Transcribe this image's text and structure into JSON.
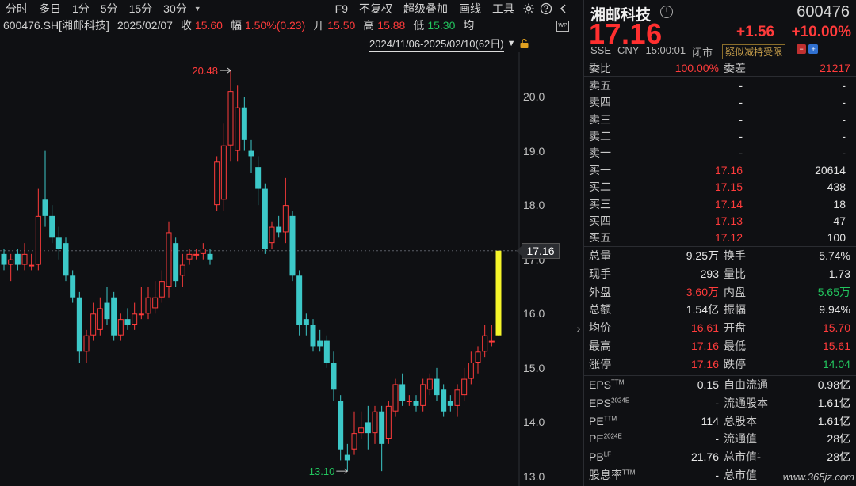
{
  "toolbar": {
    "periods": [
      "分时",
      "多日",
      "1分",
      "5分",
      "15分",
      "30分"
    ],
    "right_items": [
      "F9",
      "不复权",
      "超级叠加",
      "画线",
      "工具"
    ]
  },
  "info": {
    "code_name": "600476.SH[湘邮科技]",
    "date": "2025/02/07",
    "close_label": "收",
    "close": "15.60",
    "amp_label": "幅",
    "amp": "1.50%(0.23)",
    "open_label": "开",
    "open": "15.50",
    "high_label": "高",
    "high": "15.88",
    "low_label": "低",
    "low": "15.30",
    "avg_label": "均",
    "range": "2024/11/06-2025/02/10(62日)",
    "wp_badge": "WP"
  },
  "colors": {
    "up": "#ff3b3b",
    "down": "#3cc8c8",
    "limit_up": "#f5f52a",
    "bg": "#0f1013"
  },
  "chart_data": {
    "type": "candlestick",
    "ylim": [
      13.0,
      20.5
    ],
    "y_ticks": [
      "20.0",
      "19.0",
      "18.0",
      "17.0",
      "16.0",
      "15.0",
      "14.0",
      "13.0"
    ],
    "y_tick_values": [
      20.0,
      19.0,
      18.0,
      17.0,
      16.0,
      15.0,
      14.0,
      13.0
    ],
    "current_price": 17.16,
    "current_price_label": "17.16",
    "max_label": "20.48",
    "max_value": 20.48,
    "min_label": "13.10",
    "min_value": 13.1,
    "candles": [
      {
        "o": 17.1,
        "c": 16.9,
        "h": 17.2,
        "l": 16.8
      },
      {
        "o": 16.9,
        "c": 17.0,
        "h": 17.1,
        "l": 16.6
      },
      {
        "o": 17.1,
        "c": 16.9,
        "h": 17.2,
        "l": 16.8
      },
      {
        "o": 16.9,
        "c": 17.1,
        "h": 17.3,
        "l": 16.8
      },
      {
        "o": 16.9,
        "c": 16.9,
        "h": 17.1,
        "l": 16.8
      },
      {
        "o": 16.9,
        "c": 17.8,
        "h": 18.3,
        "l": 16.8
      },
      {
        "o": 18.1,
        "c": 17.8,
        "h": 19.0,
        "l": 17.6
      },
      {
        "o": 17.8,
        "c": 17.4,
        "h": 18.0,
        "l": 17.3
      },
      {
        "o": 17.4,
        "c": 17.2,
        "h": 17.6,
        "l": 17.0
      },
      {
        "o": 17.3,
        "c": 16.7,
        "h": 17.4,
        "l": 16.6
      },
      {
        "o": 16.7,
        "c": 16.3,
        "h": 16.8,
        "l": 16.2
      },
      {
        "o": 16.3,
        "c": 15.3,
        "h": 16.4,
        "l": 15.1
      },
      {
        "o": 15.3,
        "c": 15.6,
        "h": 15.7,
        "l": 15.1
      },
      {
        "o": 15.6,
        "c": 16.0,
        "h": 16.2,
        "l": 15.5
      },
      {
        "o": 15.7,
        "c": 16.1,
        "h": 16.3,
        "l": 15.6
      },
      {
        "o": 16.2,
        "c": 15.9,
        "h": 16.5,
        "l": 15.8
      },
      {
        "o": 16.3,
        "c": 15.6,
        "h": 16.4,
        "l": 15.5
      },
      {
        "o": 15.6,
        "c": 15.9,
        "h": 16.0,
        "l": 15.5
      },
      {
        "o": 15.9,
        "c": 15.8,
        "h": 16.1,
        "l": 15.7
      },
      {
        "o": 15.8,
        "c": 16.0,
        "h": 16.2,
        "l": 15.7
      },
      {
        "o": 16.0,
        "c": 16.0,
        "h": 16.5,
        "l": 15.9
      },
      {
        "o": 16.0,
        "c": 16.3,
        "h": 16.5,
        "l": 15.9
      },
      {
        "o": 16.1,
        "c": 16.3,
        "h": 16.6,
        "l": 16.0
      },
      {
        "o": 16.3,
        "c": 16.6,
        "h": 16.8,
        "l": 16.2
      },
      {
        "o": 16.5,
        "c": 17.5,
        "h": 17.7,
        "l": 16.3
      },
      {
        "o": 17.3,
        "c": 16.6,
        "h": 17.4,
        "l": 16.5
      },
      {
        "o": 16.7,
        "c": 16.9,
        "h": 17.1,
        "l": 16.5
      },
      {
        "o": 17.0,
        "c": 17.1,
        "h": 17.2,
        "l": 16.9
      },
      {
        "o": 17.1,
        "c": 17.1,
        "h": 17.2,
        "l": 17.0
      },
      {
        "o": 17.1,
        "c": 17.2,
        "h": 17.3,
        "l": 17.0
      },
      {
        "o": 17.1,
        "c": 17.0,
        "h": 17.2,
        "l": 16.9
      },
      {
        "o": 18.0,
        "c": 18.8,
        "h": 18.9,
        "l": 17.9
      },
      {
        "o": 18.1,
        "c": 19.1,
        "h": 19.5,
        "l": 17.9
      },
      {
        "o": 19.1,
        "c": 20.1,
        "h": 20.48,
        "l": 18.8
      },
      {
        "o": 19.0,
        "c": 19.8,
        "h": 20.2,
        "l": 18.8
      },
      {
        "o": 19.8,
        "c": 19.2,
        "h": 20.0,
        "l": 19.0
      },
      {
        "o": 19.0,
        "c": 18.9,
        "h": 19.2,
        "l": 18.6
      },
      {
        "o": 18.7,
        "c": 18.3,
        "h": 18.9,
        "l": 18.0
      },
      {
        "o": 18.3,
        "c": 17.2,
        "h": 18.4,
        "l": 17.1
      },
      {
        "o": 17.3,
        "c": 17.6,
        "h": 17.7,
        "l": 17.2
      },
      {
        "o": 17.6,
        "c": 17.5,
        "h": 17.8,
        "l": 17.4
      },
      {
        "o": 17.5,
        "c": 18.0,
        "h": 18.5,
        "l": 17.3
      },
      {
        "o": 17.8,
        "c": 16.7,
        "h": 17.9,
        "l": 16.6
      },
      {
        "o": 16.7,
        "c": 15.8,
        "h": 16.8,
        "l": 15.6
      },
      {
        "o": 15.9,
        "c": 15.8,
        "h": 16.0,
        "l": 15.6
      },
      {
        "o": 15.8,
        "c": 15.4,
        "h": 15.9,
        "l": 15.3
      },
      {
        "o": 15.5,
        "c": 15.4,
        "h": 15.7,
        "l": 15.3
      },
      {
        "o": 15.5,
        "c": 15.1,
        "h": 15.6,
        "l": 15.0
      },
      {
        "o": 15.1,
        "c": 14.6,
        "h": 15.3,
        "l": 14.4
      },
      {
        "o": 14.4,
        "c": 13.5,
        "h": 14.5,
        "l": 13.3
      },
      {
        "o": 13.4,
        "c": 13.3,
        "h": 13.6,
        "l": 13.1
      },
      {
        "o": 13.5,
        "c": 13.8,
        "h": 14.2,
        "l": 13.4
      },
      {
        "o": 13.8,
        "c": 13.9,
        "h": 14.2,
        "l": 13.7
      },
      {
        "o": 14.0,
        "c": 13.8,
        "h": 14.3,
        "l": 13.5
      },
      {
        "o": 13.8,
        "c": 14.2,
        "h": 14.3,
        "l": 13.6
      },
      {
        "o": 14.2,
        "c": 13.6,
        "h": 14.3,
        "l": 13.1
      },
      {
        "o": 13.7,
        "c": 14.3,
        "h": 14.4,
        "l": 13.6
      },
      {
        "o": 14.2,
        "c": 14.7,
        "h": 14.8,
        "l": 14.1
      },
      {
        "o": 14.7,
        "c": 14.4,
        "h": 14.9,
        "l": 14.3
      },
      {
        "o": 14.4,
        "c": 14.4,
        "h": 14.5,
        "l": 14.3
      },
      {
        "o": 14.4,
        "c": 14.3,
        "h": 14.5,
        "l": 14.2
      },
      {
        "o": 14.3,
        "c": 14.7,
        "h": 14.8,
        "l": 14.2
      },
      {
        "o": 14.6,
        "c": 14.8,
        "h": 14.9,
        "l": 14.5
      },
      {
        "o": 14.8,
        "c": 14.5,
        "h": 15.0,
        "l": 14.4
      },
      {
        "o": 14.6,
        "c": 14.2,
        "h": 14.7,
        "l": 14.1
      },
      {
        "o": 14.4,
        "c": 14.3,
        "h": 14.5,
        "l": 14.2
      },
      {
        "o": 14.3,
        "c": 14.6,
        "h": 14.7,
        "l": 14.1
      },
      {
        "o": 14.5,
        "c": 14.8,
        "h": 15.0,
        "l": 14.4
      },
      {
        "o": 14.8,
        "c": 15.1,
        "h": 15.3,
        "l": 14.7
      },
      {
        "o": 15.1,
        "c": 15.3,
        "h": 15.4,
        "l": 14.9
      },
      {
        "o": 15.3,
        "c": 15.6,
        "h": 15.8,
        "l": 15.2
      },
      {
        "o": 15.5,
        "c": 15.5,
        "h": 15.8,
        "l": 15.4
      },
      {
        "o": 15.6,
        "c": 17.16,
        "h": 17.16,
        "l": 15.6,
        "limit": true
      }
    ]
  },
  "panel": {
    "name": "湘邮科技",
    "info_icon": "!",
    "code": "600476",
    "price": "17.16",
    "change": "+1.56",
    "change_pct": "+10.00%",
    "meta": [
      "SSE",
      "CNY",
      "15:00:01",
      "闭市"
    ],
    "flag": "疑似减持受限",
    "weibi_label": "委比",
    "weibi": "100.00%",
    "weicha_label": "委差",
    "weicha": "21217",
    "sells": [
      {
        "label": "卖五",
        "price": "-",
        "vol": "-"
      },
      {
        "label": "卖四",
        "price": "-",
        "vol": "-"
      },
      {
        "label": "卖三",
        "price": "-",
        "vol": "-"
      },
      {
        "label": "卖二",
        "price": "-",
        "vol": "-"
      },
      {
        "label": "卖一",
        "price": "-",
        "vol": "-"
      }
    ],
    "buys": [
      {
        "label": "买一",
        "price": "17.16",
        "vol": "20614"
      },
      {
        "label": "买二",
        "price": "17.15",
        "vol": "438"
      },
      {
        "label": "买三",
        "price": "17.14",
        "vol": "18"
      },
      {
        "label": "买四",
        "price": "17.13",
        "vol": "47"
      },
      {
        "label": "买五",
        "price": "17.12",
        "vol": "100"
      }
    ],
    "stats": [
      {
        "l1": "总量",
        "v1": "9.25万",
        "c1": "white",
        "l2": "换手",
        "v2": "5.74%",
        "c2": "white"
      },
      {
        "l1": "现手",
        "v1": "293",
        "c1": "white",
        "l2": "量比",
        "v2": "1.73",
        "c2": "white"
      },
      {
        "l1": "外盘",
        "v1": "3.60万",
        "c1": "red",
        "l2": "内盘",
        "v2": "5.65万",
        "c2": "green"
      },
      {
        "l1": "总额",
        "v1": "1.54亿",
        "c1": "white",
        "l2": "振幅",
        "v2": "9.94%",
        "c2": "white"
      },
      {
        "l1": "均价",
        "v1": "16.61",
        "c1": "red",
        "l2": "开盘",
        "v2": "15.70",
        "c2": "red"
      },
      {
        "l1": "最高",
        "v1": "17.16",
        "c1": "red",
        "l2": "最低",
        "v2": "15.61",
        "c2": "red"
      },
      {
        "l1": "涨停",
        "v1": "17.16",
        "c1": "red",
        "l2": "跌停",
        "v2": "14.04",
        "c2": "green"
      }
    ],
    "fundamentals": [
      {
        "l1": "EPS",
        "s1": "TTM",
        "v1": "0.15",
        "l2": "自由流通",
        "v2": "0.98亿"
      },
      {
        "l1": "EPS",
        "s1": "2024E",
        "v1": "-",
        "l2": "流通股本",
        "v2": "1.61亿"
      },
      {
        "l1": "PE",
        "s1": "TTM",
        "v1": "114",
        "l2": "总股本",
        "v2": "1.61亿"
      },
      {
        "l1": "PE",
        "s1": "2024E",
        "v1": "-",
        "l2": "流通值",
        "v2": "28亿"
      },
      {
        "l1": "PB",
        "s1": "LF",
        "v1": "21.76",
        "l2": "总市值¹",
        "v2": "28亿"
      },
      {
        "l1": "股息率",
        "s1": "TTM",
        "v1": "-",
        "l2": "总市值",
        "v2": ""
      }
    ],
    "watermark": "www.365jz.com"
  }
}
